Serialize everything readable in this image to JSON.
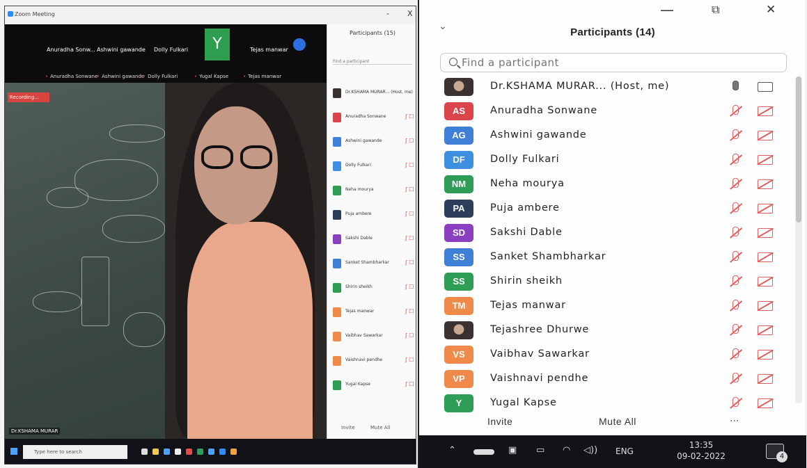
{
  "left": {
    "title": "Zoom Meeting",
    "window_buttons": [
      "-",
      "X"
    ],
    "gallery": [
      {
        "name": "Anuradha Sonw...",
        "mini": "Anuradha Sonwane"
      },
      {
        "name": "Ashwini gawande",
        "mini": "Ashwini gawande"
      },
      {
        "name": "Dolly Fulkari",
        "mini": "Dolly Fulkari"
      },
      {
        "name": "",
        "mini": "Yugal Kapse"
      },
      {
        "name": "Tejas manwar",
        "mini": "Tejas manwar"
      }
    ],
    "y_tile": "Y",
    "speaker_label": "Recording...",
    "stage_name": "Dr.KSHAMA MURAR",
    "panel_title": "Participants (15)",
    "panel_search": "Find a participant",
    "panel_rows": [
      "Dr.KSHAMA MURAR... (Host, me)",
      "Anuradha Sonwane",
      "Ashwini gawande",
      "Dolly Fulkari",
      "Neha mourya",
      "Puja ambere",
      "Sakshi Dable",
      "Sanket Shambharkar",
      "Shirin sheikh",
      "Tejas manwar",
      "Vaibhav Sawarkar",
      "Vaishnavi pendhe",
      "Yugal Kapse"
    ],
    "panel_footer": {
      "invite": "Invite",
      "mute_all": "Mute All"
    },
    "taskbar_search": "Type here to search"
  },
  "right": {
    "window_buttons": {
      "minimize": "—",
      "restore": "⧉",
      "close": "✕"
    },
    "collapse_icon": "chevron-down-icon",
    "title": "Participants (14)",
    "search_placeholder": "Find a participant",
    "participants": [
      {
        "initials": "",
        "name": "Dr.KSHAMA MURAR... (Host, me)",
        "color": "",
        "host": true,
        "photo": true
      },
      {
        "initials": "AS",
        "name": "Anuradha Sonwane",
        "color": "#d9454b"
      },
      {
        "initials": "AG",
        "name": "Ashwini gawande",
        "color": "#3f7fd6"
      },
      {
        "initials": "DF",
        "name": "Dolly Fulkari",
        "color": "#3f8fe0"
      },
      {
        "initials": "NM",
        "name": "Neha mourya",
        "color": "#2e9e57"
      },
      {
        "initials": "PA",
        "name": "Puja ambere",
        "color": "#2d3e5b"
      },
      {
        "initials": "SD",
        "name": "Sakshi Dable",
        "color": "#8a3fc0"
      },
      {
        "initials": "SS",
        "name": "Sanket Shambharkar",
        "color": "#3f7fd6"
      },
      {
        "initials": "SS",
        "name": "Shirin sheikh",
        "color": "#2e9e57"
      },
      {
        "initials": "TM",
        "name": "Tejas manwar",
        "color": "#f08a4b"
      },
      {
        "initials": "",
        "name": "Tejashree Dhurwe",
        "color": "",
        "photo": true
      },
      {
        "initials": "VS",
        "name": "Vaibhav Sawarkar",
        "color": "#f08a4b"
      },
      {
        "initials": "VP",
        "name": "Vaishnavi pendhe",
        "color": "#f08a4b"
      },
      {
        "initials": "Y",
        "name": "Yugal Kapse",
        "color": "#2e9e57"
      }
    ],
    "footer": {
      "invite": "Invite",
      "mute_all": "Mute All",
      "more": "..."
    },
    "taskbar": {
      "language": "ENG",
      "time": "13:35",
      "date": "09-02-2022",
      "notification_count": "4"
    }
  }
}
